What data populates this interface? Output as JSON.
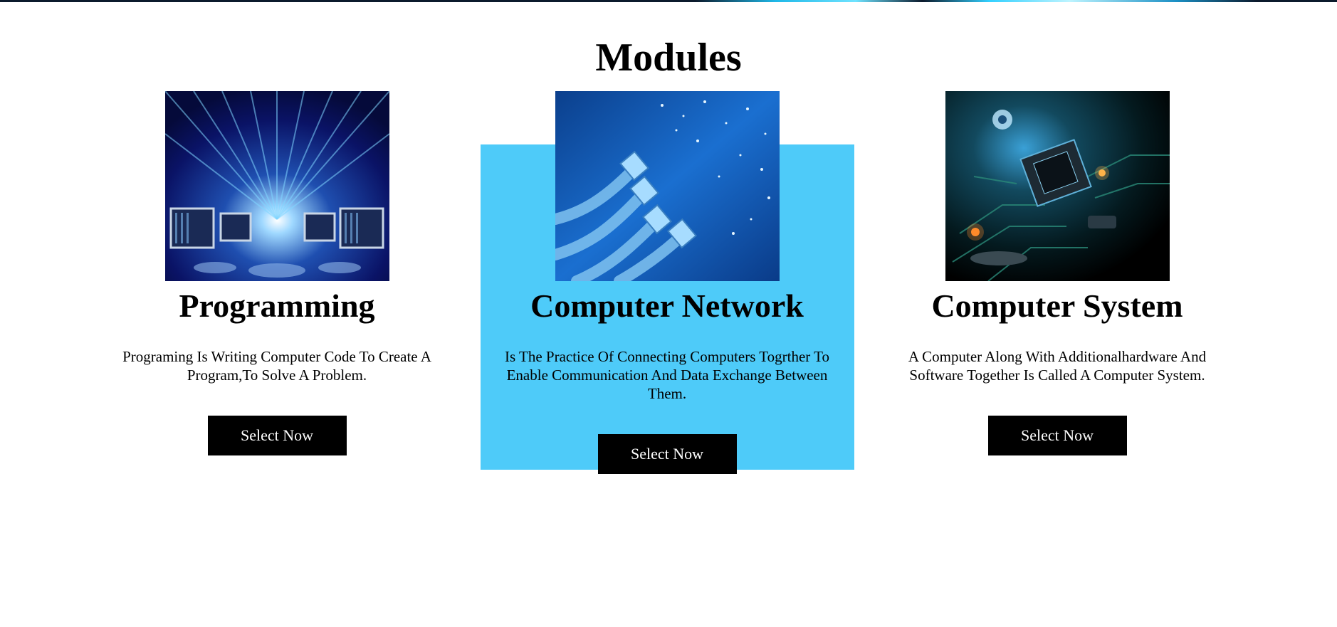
{
  "page": {
    "title": "Modules"
  },
  "colors": {
    "highlight": "#4ecbf9",
    "button_bg": "#000000",
    "button_text": "#ffffff"
  },
  "modules": [
    {
      "title": "Programming",
      "description": "Programing Is Writing Computer Code To Create A Program,To Solve A Problem.",
      "button_label": "Select Now",
      "image": "programming-image"
    },
    {
      "title": "Computer Network",
      "description": "Is The Practice Of Connecting Computers Togrther To Enable Communication And Data Exchange Between Them.",
      "button_label": "Select Now",
      "image": "network-cables-image"
    },
    {
      "title": "Computer System",
      "description": "A Computer Along With Additionalhardware And Software Together Is Called A Computer System.",
      "button_label": "Select Now",
      "image": "circuit-board-image"
    }
  ]
}
